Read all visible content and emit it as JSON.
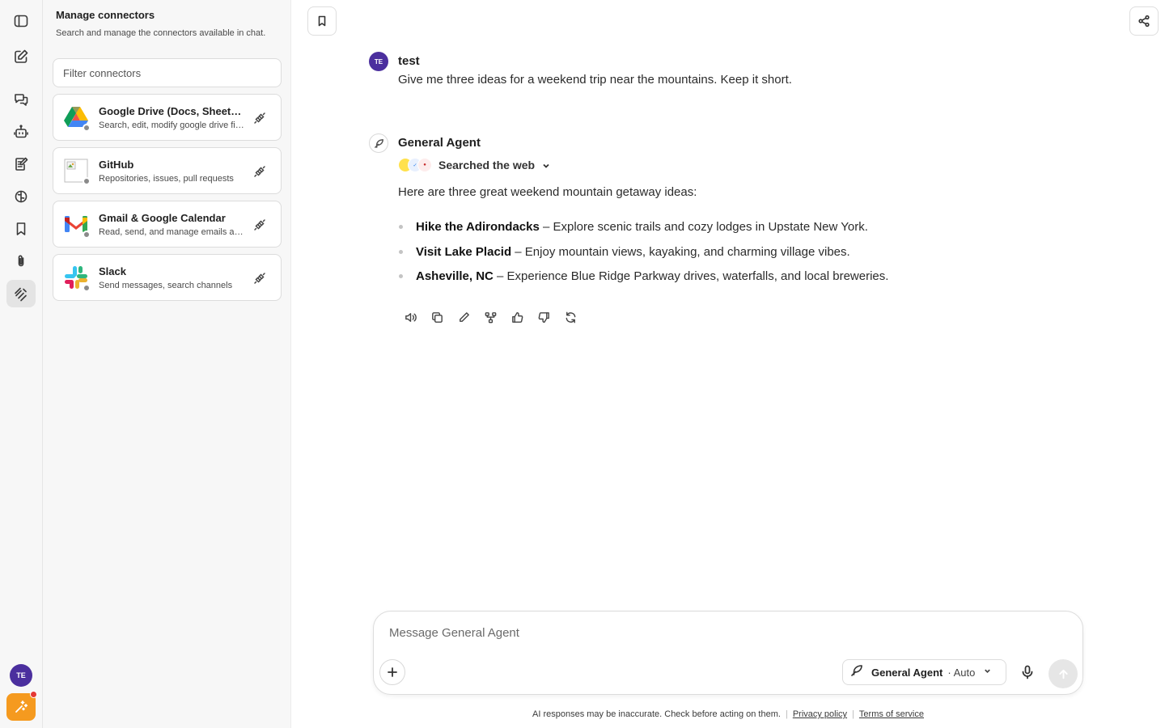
{
  "rail": {
    "items": [
      {
        "name": "sidebar-toggle-icon"
      },
      {
        "name": "new-chat-icon"
      },
      {
        "name": "chats-icon"
      },
      {
        "name": "agents-icon"
      },
      {
        "name": "notes-icon"
      },
      {
        "name": "knowledge-icon"
      },
      {
        "name": "bookmarks-icon"
      },
      {
        "name": "attachments-icon"
      },
      {
        "name": "connectors-icon",
        "active": true
      }
    ],
    "avatar_initials": "TE"
  },
  "connectors_panel": {
    "title": "Manage connectors",
    "subtitle": "Search and manage the connectors available in chat.",
    "filter_placeholder": "Filter connectors",
    "items": [
      {
        "name": "Google Drive (Docs, Sheets, Slides)",
        "description": "Search, edit, modify google drive files",
        "logo": "google-drive-logo"
      },
      {
        "name": "GitHub",
        "description": "Repositories, issues, pull requests",
        "logo": "github-logo-broken-image"
      },
      {
        "name": "Gmail & Google Calendar",
        "description": "Read, send, and manage emails and events",
        "logo": "gmail-logo"
      },
      {
        "name": "Slack",
        "description": "Send messages, search channels",
        "logo": "slack-logo"
      }
    ]
  },
  "conversation": {
    "user": {
      "initials": "TE",
      "name": "test",
      "message": "Give me three ideas for a weekend trip near the mountains. Keep it short."
    },
    "agent": {
      "name": "General Agent",
      "searched_label": "Searched the web",
      "intro": "Here are three great weekend mountain getaway ideas:",
      "ideas": [
        {
          "title": "Hike the Adirondacks",
          "detail": " – Explore scenic trails and cozy lodges in Upstate New York."
        },
        {
          "title": "Visit Lake Placid",
          "detail": " – Enjoy mountain views, kayaking, and charming village vibes."
        },
        {
          "title": "Asheville, NC",
          "detail": " – Experience Blue Ridge Parkway drives, waterfalls, and local breweries."
        }
      ],
      "actions": [
        "read-aloud-icon",
        "copy-icon",
        "edit-icon",
        "branch-icon",
        "thumbs-up-icon",
        "thumbs-down-icon",
        "regenerate-icon"
      ]
    }
  },
  "composer": {
    "placeholder": "Message General Agent",
    "agent_name": "General Agent",
    "mode": "· Auto"
  },
  "footer": {
    "disclaimer": "AI responses may be inaccurate. Check before acting on them.",
    "privacy": "Privacy policy",
    "terms": "Terms of service"
  },
  "colors": {
    "avatar": "#4b2f9e",
    "spark_button": "#f59a1f",
    "notification_dot": "#e53935"
  }
}
